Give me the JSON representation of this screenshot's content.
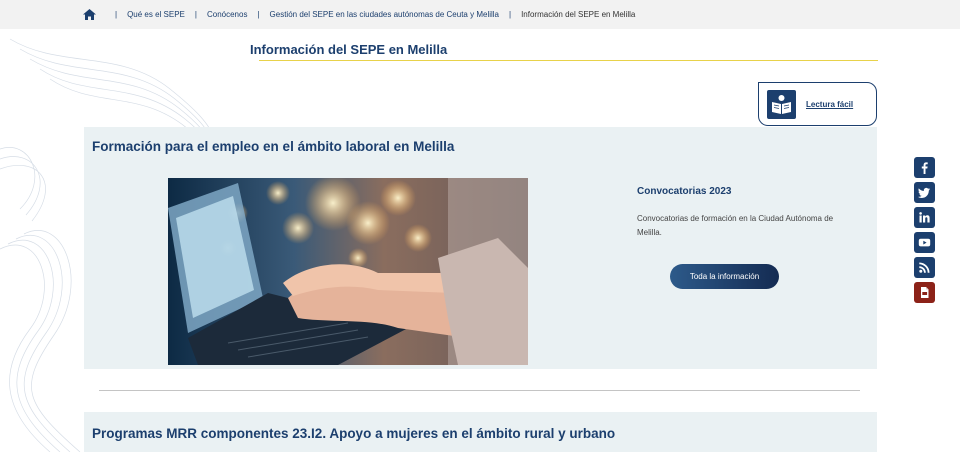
{
  "breadcrumb": {
    "items": [
      "Qué es el SEPE",
      "Conócenos",
      "Gestión del SEPE en las ciudades autónomas de Ceuta y Melilla"
    ],
    "current": "Información del SEPE en Melilla"
  },
  "page": {
    "title": "Información del SEPE en Melilla"
  },
  "easy_read": {
    "label": "Lectura fácil",
    "icon": "easy-read-book-icon"
  },
  "section1": {
    "title": "Formación para el empleo en el ámbito laboral en Melilla",
    "subtitle": "Convocatorias 2023",
    "description": "Convocatorias de formación en la Ciudad Autónoma de Melilla.",
    "button_label": "Toda la información"
  },
  "section2": {
    "title": "Programas MRR componentes 23.I2. Apoyo a mujeres en el ámbito rural y urbano"
  },
  "social": [
    "facebook-icon",
    "twitter-icon",
    "linkedin-icon",
    "youtube-icon",
    "rss-icon",
    "pdf-icon"
  ],
  "colors": {
    "brand": "#1c3f6e",
    "accent_line": "#e8d24a",
    "card_bg": "#eaf1f3",
    "pdf": "#8c2218"
  }
}
